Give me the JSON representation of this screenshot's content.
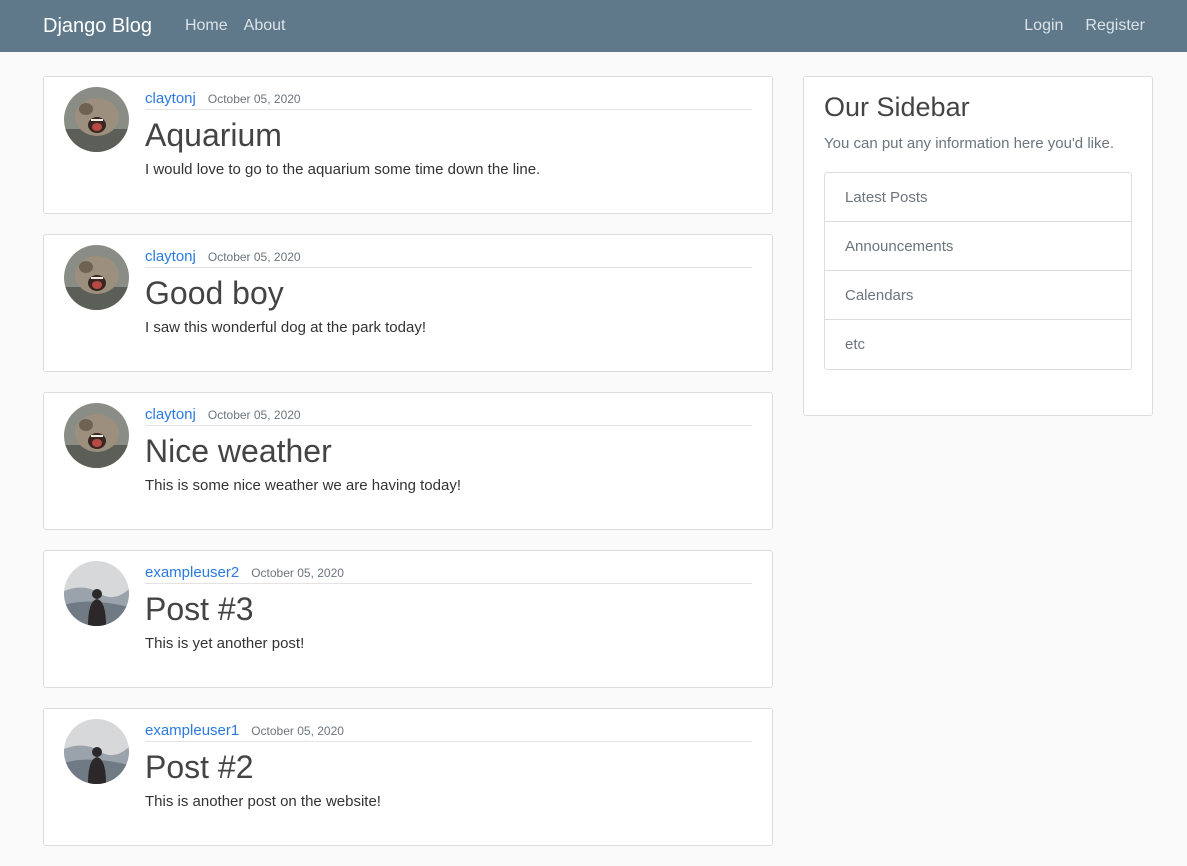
{
  "navbar": {
    "brand": "Django Blog",
    "left_links": [
      {
        "label": "Home"
      },
      {
        "label": "About"
      }
    ],
    "right_links": [
      {
        "label": "Login"
      },
      {
        "label": "Register"
      }
    ],
    "bg_color": "#5f788a"
  },
  "posts": [
    {
      "author": "claytonj",
      "date": "October 05, 2020",
      "title": "Aquarium",
      "content": "I would love to go to the aquarium some time down the line.",
      "avatar": "bear-avatar"
    },
    {
      "author": "claytonj",
      "date": "October 05, 2020",
      "title": "Good boy",
      "content": "I saw this wonderful dog at the park today!",
      "avatar": "bear-avatar"
    },
    {
      "author": "claytonj",
      "date": "October 05, 2020",
      "title": "Nice weather",
      "content": "This is some nice weather we are having today!",
      "avatar": "bear-avatar"
    },
    {
      "author": "exampleuser2",
      "date": "October 05, 2020",
      "title": "Post #3",
      "content": "This is yet another post!",
      "avatar": "person-avatar"
    },
    {
      "author": "exampleuser1",
      "date": "October 05, 2020",
      "title": "Post #2",
      "content": "This is another post on the website!",
      "avatar": "person-avatar"
    }
  ],
  "sidebar": {
    "title": "Our Sidebar",
    "text": "You can put any information here you'd like.",
    "items": [
      {
        "label": "Latest Posts"
      },
      {
        "label": "Announcements"
      },
      {
        "label": "Calendars"
      },
      {
        "label": "etc"
      }
    ]
  },
  "colors": {
    "link": "#2a7ae2",
    "muted": "#6c757d"
  }
}
